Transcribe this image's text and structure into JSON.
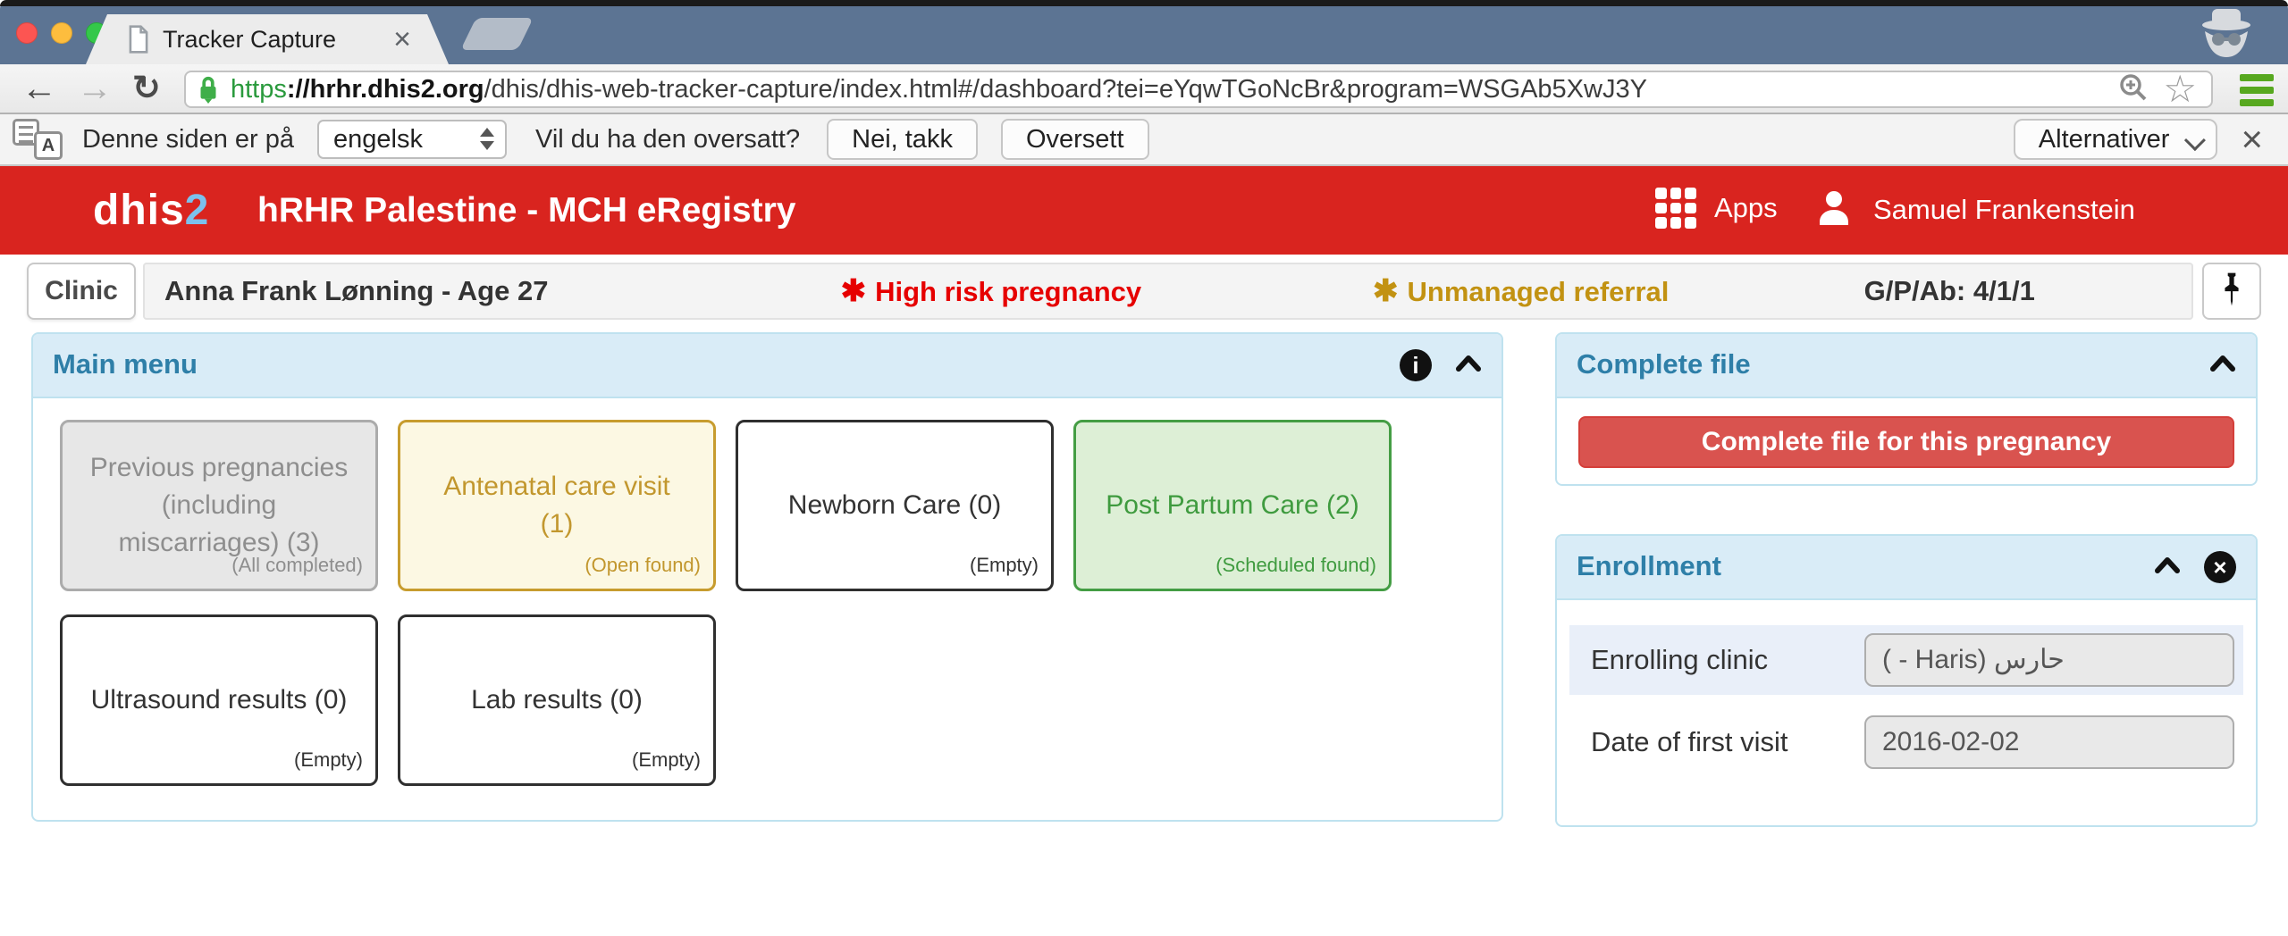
{
  "browser": {
    "tab_title": "Tracker Capture",
    "url": {
      "scheme": "https",
      "domain": "://hrhr.dhis2.org",
      "path": "/dhis/dhis-web-tracker-capture/index.html#/dashboard?tei=eYqwTGoNcBr&program=WSGAb5XwJ3Y"
    }
  },
  "translate_bar": {
    "message": "Denne siden er på",
    "language_value": "engelsk",
    "question": "Vil du ha den oversatt?",
    "decline_button": "Nei, takk",
    "accept_button": "Oversett",
    "options_button": "Alternativer"
  },
  "app_header": {
    "logo_prefix": "dhis",
    "logo_suffix": "2",
    "title": "hRHR Palestine - MCH eRegistry",
    "apps_label": "Apps",
    "user_name": "Samuel Frankenstein"
  },
  "patient_bar": {
    "org_unit_button": "Clinic",
    "patient_name": "Anna Frank Lønning - Age 27",
    "high_risk_flag": "High risk pregnancy",
    "referral_flag": "Unmanaged referral",
    "gpab": "G/P/Ab: 4/1/1"
  },
  "main_menu": {
    "title": "Main menu",
    "cards": [
      {
        "label": "Previous pregnancies (including miscarriages) (3)",
        "status": "(All completed)"
      },
      {
        "label": "Antenatal care visit (1)",
        "status": "(Open found)"
      },
      {
        "label": "Newborn Care (0)",
        "status": "(Empty)"
      },
      {
        "label": "Post Partum Care (2)",
        "status": "(Scheduled found)"
      },
      {
        "label": "Ultrasound results (0)",
        "status": "(Empty)"
      },
      {
        "label": "Lab results (0)",
        "status": "(Empty)"
      }
    ]
  },
  "complete_file": {
    "title": "Complete file",
    "button": "Complete file for this pregnancy"
  },
  "enrollment": {
    "title": "Enrollment",
    "fields": [
      {
        "label": "Enrolling clinic",
        "value": "( - Haris) حارس"
      },
      {
        "label": "Date of first visit",
        "value": "2016-02-02"
      }
    ]
  },
  "icons": {
    "asterisk": "✱",
    "close": "×",
    "star": "☆",
    "back": "←",
    "forward": "→",
    "reload": "↻",
    "info": "i",
    "letter_a": "A"
  },
  "colors": {
    "brand_red": "#d9241f",
    "logo_blue": "#7cc1ed",
    "panel_heading_bg": "#d9ecf7",
    "panel_border": "#bfe2ef",
    "panel_title_text": "#2e7fa8",
    "danger_button": "#d9534f",
    "high_risk_text": "#e60000",
    "referral_text": "#c29212",
    "card_yellow_bg": "#fcf8e3",
    "card_green_bg": "#ddefd6",
    "card_gray_bg": "#e7e7e7",
    "secure_lock_green": "#3fae49",
    "menu_bars_green": "#57a81f",
    "tabbar_bg": "#5c7493"
  }
}
